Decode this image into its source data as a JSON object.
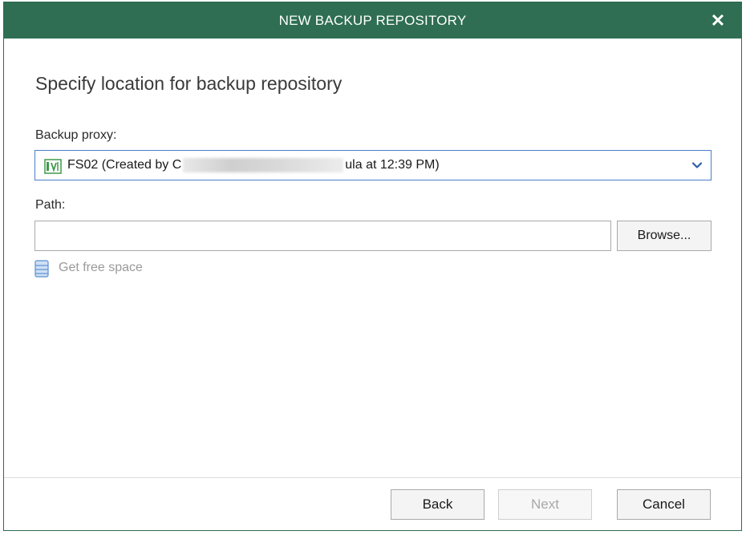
{
  "window": {
    "title": "NEW BACKUP REPOSITORY",
    "close_glyph": "✕"
  },
  "page": {
    "heading": "Specify location for backup repository"
  },
  "proxy": {
    "label": "Backup proxy:",
    "selected_prefix": "FS02 (Created by C",
    "selected_suffix": "ula at 12:39 PM)",
    "icon": "server-icon",
    "dropdown_icon": "chevron-down-icon"
  },
  "path": {
    "label": "Path:",
    "value": "",
    "placeholder": "",
    "browse_label": "Browse..."
  },
  "free_space": {
    "label": "Get free space",
    "icon": "database-icon"
  },
  "footer": {
    "back_label": "Back",
    "next_label": "Next",
    "cancel_label": "Cancel",
    "next_enabled": false
  },
  "colors": {
    "titlebar": "#2f6e52",
    "focus_border": "#4a7fc9",
    "icon_green": "#3f9b4a",
    "icon_blue": "#5b8fd1",
    "disabled_text": "#a8a8a8"
  }
}
